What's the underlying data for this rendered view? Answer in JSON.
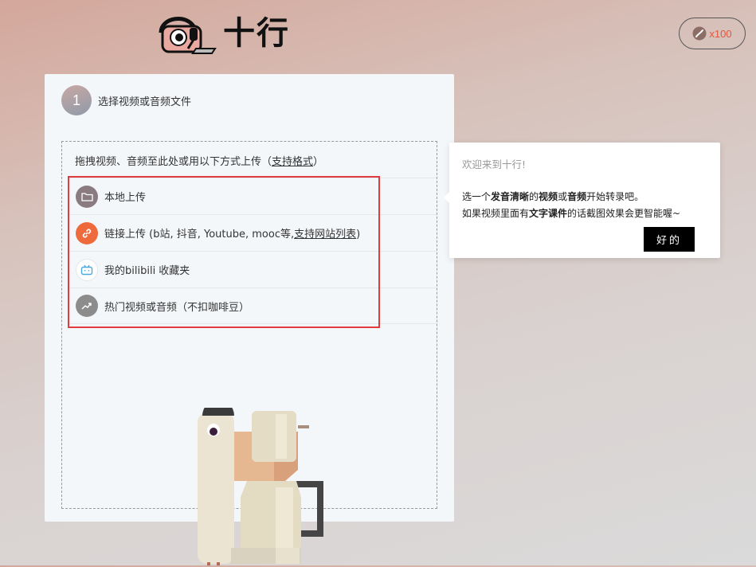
{
  "header": {
    "logo_text": "十行",
    "coin_count": "x100"
  },
  "step": {
    "number": "1",
    "label": "选择视频或音频文件"
  },
  "drop_zone": {
    "hint_text": "拖拽视频、音频至此处或用以下方式上传（",
    "hint_link": "支持格式",
    "hint_end": "）"
  },
  "options": [
    {
      "icon": "folder-icon",
      "label": "本地上传",
      "color": "#8a7b80"
    },
    {
      "icon": "link-icon",
      "label": "链接上传 (b站, 抖音, Youtube, mooc等,",
      "link": "支持网站列表",
      "end": ")",
      "color": "#ee6a3d"
    },
    {
      "icon": "bilibili-icon",
      "label": "我的bilibili 收藏夹",
      "color": "#ffffff"
    },
    {
      "icon": "trending-icon",
      "label": "热门视频或音频（不扣咖啡豆）",
      "color": "#8c8c8c"
    }
  ],
  "popup": {
    "title": "欢迎来到十行!",
    "line1_a": "选一个",
    "line1_b": "发音清晰",
    "line1_c": "的",
    "line1_d": "视频",
    "line1_e": "或",
    "line1_f": "音频",
    "line1_g": "开始转录吧。",
    "line2_a": "如果视频里面有",
    "line2_b": "文字课件",
    "line2_c": "的话截图效果会更智能喔~",
    "ok_label": "好的"
  },
  "colors": {
    "accent": "#e4553e",
    "highlight": "#e03b3f"
  }
}
